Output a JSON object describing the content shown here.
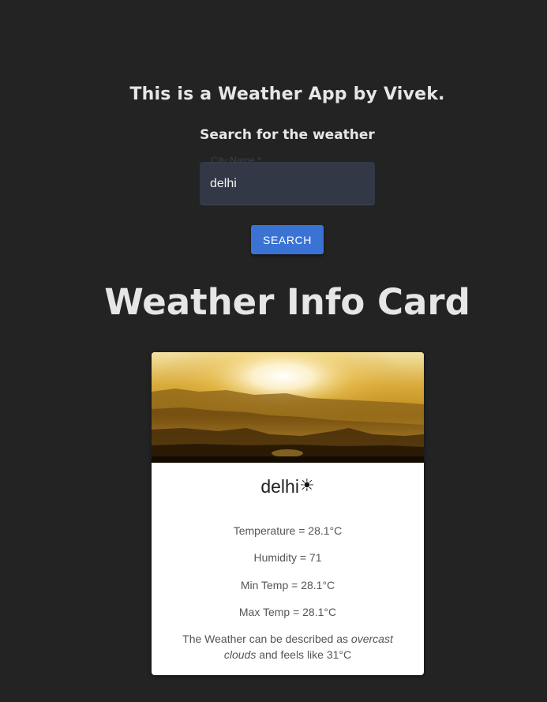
{
  "header": {
    "title": "This is a Weather App by Vivek.",
    "search_heading": "Search for the weather"
  },
  "search": {
    "label": "City Name *",
    "value": "delhi",
    "button_label": "SEARCH"
  },
  "card_section": {
    "title": "Weather Info Card"
  },
  "weather": {
    "city": "delhi",
    "icon": "sun-icon",
    "temperature": "Temperature = 28.1°C",
    "humidity": "Humidity = 71",
    "min_temp": "Min Temp = 28.1°C",
    "max_temp": "Max Temp = 28.1°C",
    "description_prefix": "The Weather can be described as ",
    "condition": "overcast clouds",
    "description_middle": " and feels like ",
    "feels_like": "31°C"
  },
  "colors": {
    "background": "#232323",
    "accent": "#3a73d4",
    "card": "#ffffff",
    "input_fill": "#323846"
  }
}
